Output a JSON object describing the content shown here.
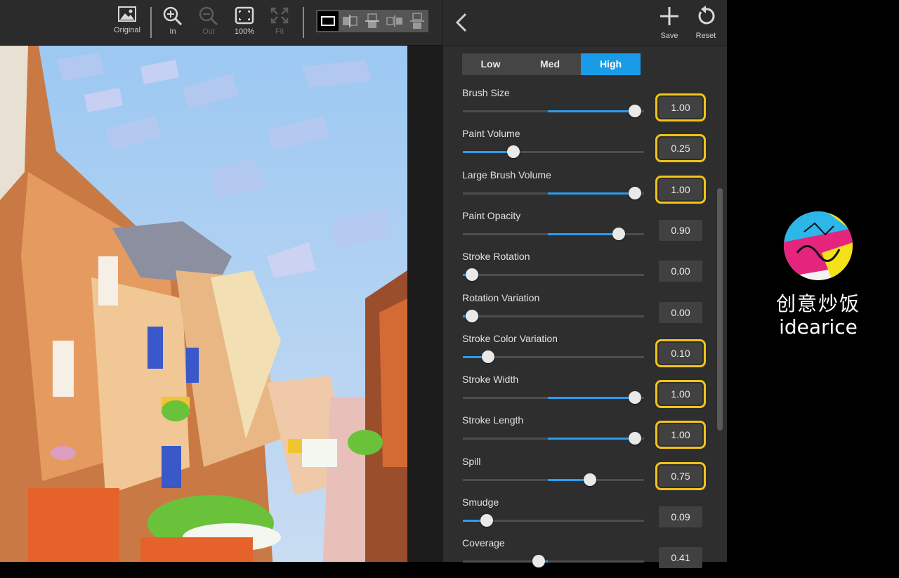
{
  "toolbar": {
    "items": [
      {
        "label": "Original",
        "icon": "image-icon"
      },
      {
        "label": "In",
        "icon": "zoom-in-icon"
      },
      {
        "label": "Out",
        "icon": "zoom-out-icon"
      },
      {
        "label": "100%",
        "icon": "actual-size-icon"
      },
      {
        "label": "Fit",
        "icon": "fit-icon"
      }
    ],
    "view_modes": [
      "single-view",
      "split-vertical",
      "split-horizontal",
      "side-by-side",
      "stacked"
    ]
  },
  "header": {
    "save_label": "Save",
    "reset_label": "Reset"
  },
  "quality": {
    "options": [
      "Low",
      "Med",
      "High"
    ],
    "selected": "High"
  },
  "sliders": [
    {
      "label": "Brush Size",
      "value": "1.00",
      "level": 0.95,
      "bipolar": true,
      "highlighted": true
    },
    {
      "label": "Paint Volume",
      "value": "0.25",
      "level": 0.28,
      "bipolar": false,
      "highlighted": true
    },
    {
      "label": "Large Brush Volume",
      "value": "1.00",
      "level": 0.95,
      "bipolar": true,
      "highlighted": true
    },
    {
      "label": "Paint Opacity",
      "value": "0.90",
      "level": 0.86,
      "bipolar": true,
      "highlighted": false
    },
    {
      "label": "Stroke Rotation",
      "value": "0.00",
      "level": 0.05,
      "bipolar": false,
      "highlighted": false
    },
    {
      "label": "Rotation Variation",
      "value": "0.00",
      "level": 0.05,
      "bipolar": false,
      "highlighted": false
    },
    {
      "label": "Stroke Color Variation",
      "value": "0.10",
      "level": 0.14,
      "bipolar": false,
      "highlighted": true
    },
    {
      "label": "Stroke Width",
      "value": "1.00",
      "level": 0.95,
      "bipolar": true,
      "highlighted": true
    },
    {
      "label": "Stroke Length",
      "value": "1.00",
      "level": 0.95,
      "bipolar": true,
      "highlighted": true
    },
    {
      "label": "Spill",
      "value": "0.75",
      "level": 0.7,
      "bipolar": true,
      "highlighted": true
    },
    {
      "label": "Smudge",
      "value": "0.09",
      "level": 0.13,
      "bipolar": false,
      "highlighted": false
    },
    {
      "label": "Coverage",
      "value": "0.41",
      "level": 0.42,
      "bipolar": true,
      "highlighted": false
    }
  ],
  "watermark": {
    "chinese": "创意炒饭",
    "english": "idearice"
  },
  "colors": {
    "accent": "#1a9be8",
    "highlight": "#f2c318",
    "panel_bg": "#2e2e2e"
  }
}
